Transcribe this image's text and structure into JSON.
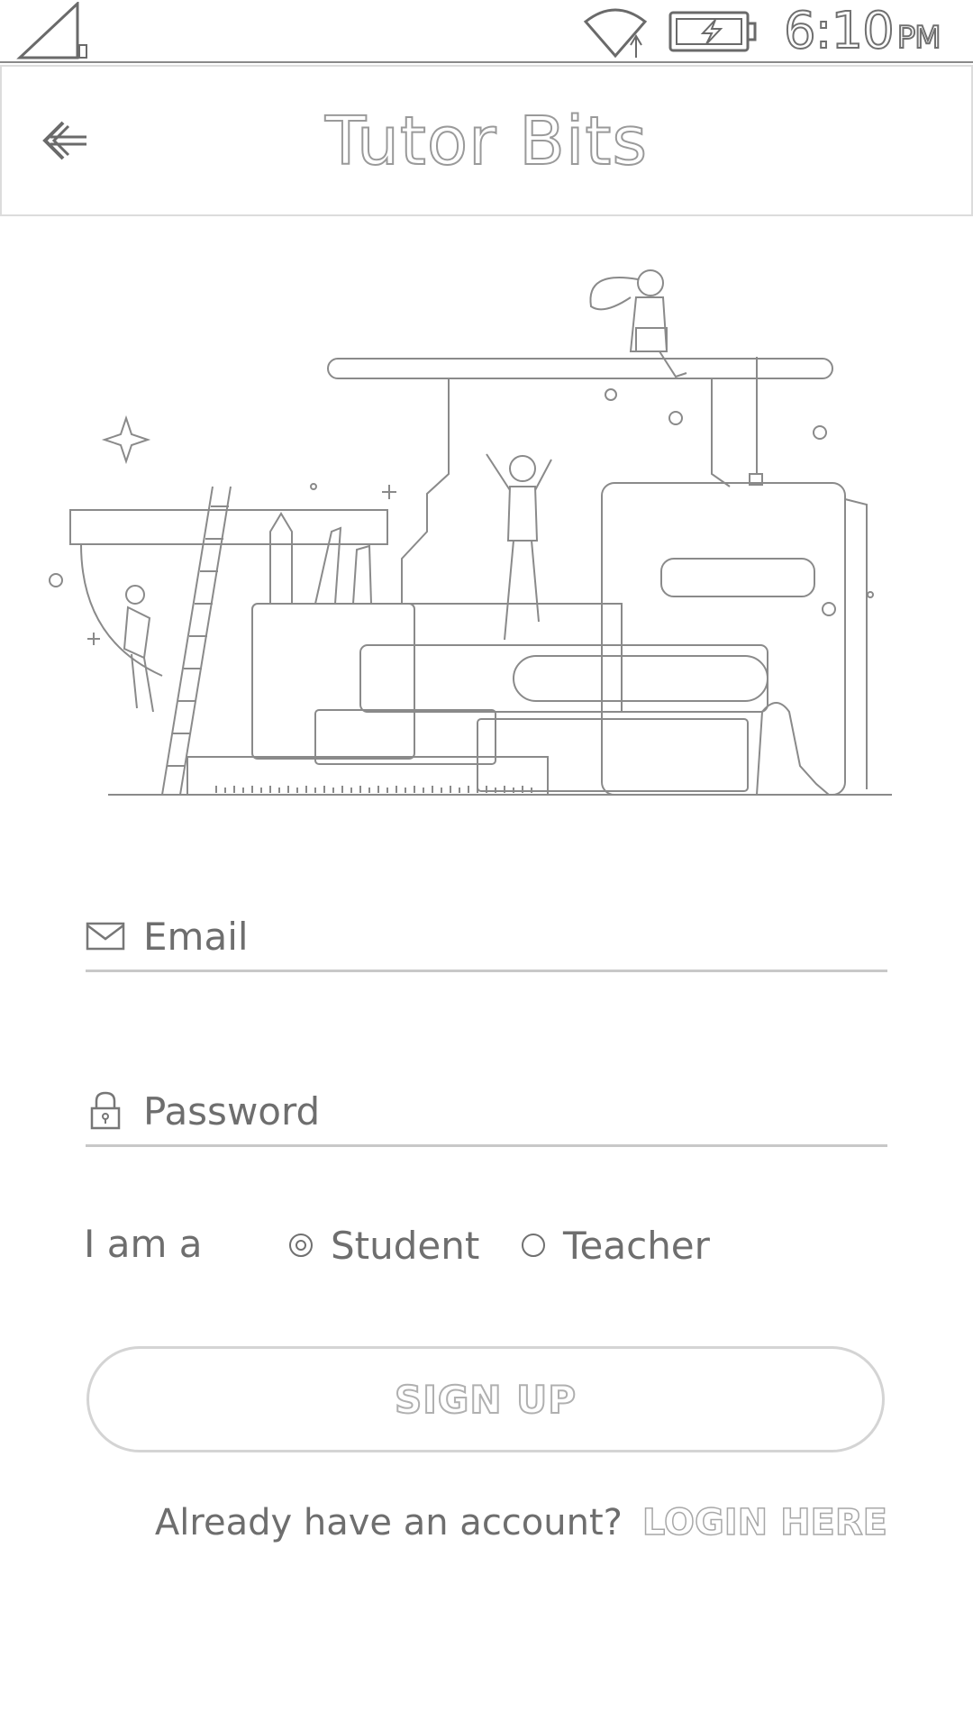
{
  "status_bar": {
    "time": "6:10",
    "ampm": "PM",
    "signal_icon": "cell-signal-icon",
    "wifi_icon": "wifi-icon",
    "battery_icon": "battery-charging-icon"
  },
  "app_bar": {
    "title": "Tutor Bits",
    "back_icon": "back-arrow-icon"
  },
  "illustration": {
    "name": "education-books-illustration"
  },
  "form": {
    "email": {
      "placeholder": "Email",
      "value": "",
      "icon": "mail-icon"
    },
    "password": {
      "placeholder": "Password",
      "value": "",
      "icon": "lock-icon"
    },
    "role": {
      "label": "I am a",
      "options": [
        {
          "label": "Student",
          "selected": true
        },
        {
          "label": "Teacher",
          "selected": false
        }
      ]
    },
    "signup_button": "SIGN UP"
  },
  "footer": {
    "question": "Already have an account?",
    "login_link": "LOGIN HERE"
  },
  "colors": {
    "background": "#ffffff",
    "outline": "#9a9a9a",
    "text": "#6e6e6e",
    "divider": "#c8c8c8"
  }
}
